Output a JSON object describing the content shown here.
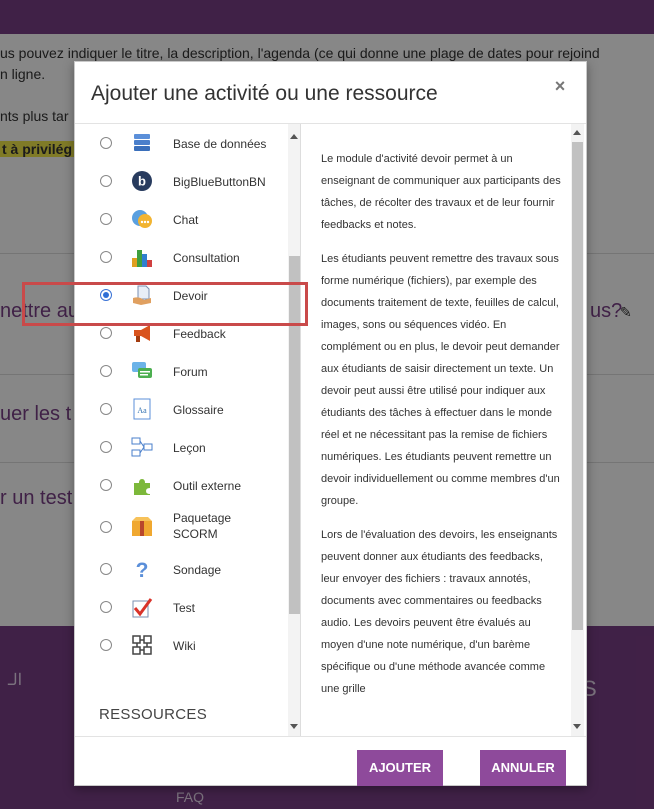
{
  "background": {
    "line1": "us pouvez indiquer le titre, la description, l'agenda (ce qui donne une plage de dates pour rejoind",
    "line2": "n ligne.",
    "line3": "nts plus tar",
    "highlight": "t à privilég",
    "heading1": "nettre au",
    "heading1_right": "us?",
    "heading2": "uer les t",
    "heading3": "r un test",
    "footer_logo": "الـ",
    "footer_letter": "S",
    "footer_faq": "FAQ"
  },
  "modal": {
    "title": "Ajouter une activité ou une ressource",
    "close": "×",
    "items": [
      {
        "label": "Base de données",
        "icon": "database-icon"
      },
      {
        "label": "BigBlueButtonBN",
        "icon": "bigbluebutton-icon"
      },
      {
        "label": "Chat",
        "icon": "chat-icon"
      },
      {
        "label": "Consultation",
        "icon": "bar-chart-icon"
      },
      {
        "label": "Devoir",
        "icon": "assignment-icon",
        "selected": true
      },
      {
        "label": "Feedback",
        "icon": "megaphone-icon"
      },
      {
        "label": "Forum",
        "icon": "forum-icon"
      },
      {
        "label": "Glossaire",
        "icon": "glossary-icon"
      },
      {
        "label": "Leçon",
        "icon": "lesson-icon"
      },
      {
        "label": "Outil externe",
        "icon": "puzzle-icon"
      },
      {
        "label": "Paquetage SCORM",
        "icon": "scorm-package-icon"
      },
      {
        "label": "Sondage",
        "icon": "question-icon"
      },
      {
        "label": "Test",
        "icon": "quiz-check-icon"
      },
      {
        "label": "Wiki",
        "icon": "wiki-icon"
      }
    ],
    "section_resources": "RESSOURCES",
    "description": [
      "Le module d'activité devoir permet à un enseignant de communiquer aux participants des tâches, de récolter des travaux et de leur fournir feedbacks et notes.",
      "Les étudiants peuvent remettre des travaux sous forme numérique (fichiers), par exemple des documents traitement de texte, feuilles de calcul, images, sons ou séquences vidéo. En complément ou en plus, le devoir peut demander aux étudiants de saisir directement un texte. Un devoir peut aussi être utilisé pour indiquer aux étudiants des tâches à effectuer dans le monde réel et ne nécessitant pas la remise de fichiers numériques. Les étudiants peuvent remettre un devoir individuellement ou comme membres d'un groupe.",
      "Lors de l'évaluation des devoirs, les enseignants peuvent donner aux étudiants des feedbacks, leur envoyer des fichiers : travaux annotés, documents avec commentaires ou feedbacks audio. Les devoirs peuvent être évalués au moyen d'une note numérique, d'un barème spécifique ou d'une méthode avancée comme une grille"
    ],
    "add_label": "AJOUTER",
    "cancel_label": "ANNULER"
  },
  "colors": {
    "accent": "#8e4a9b",
    "highlight_box": "#c94a4a",
    "selected_radio": "#2f6fd6"
  }
}
